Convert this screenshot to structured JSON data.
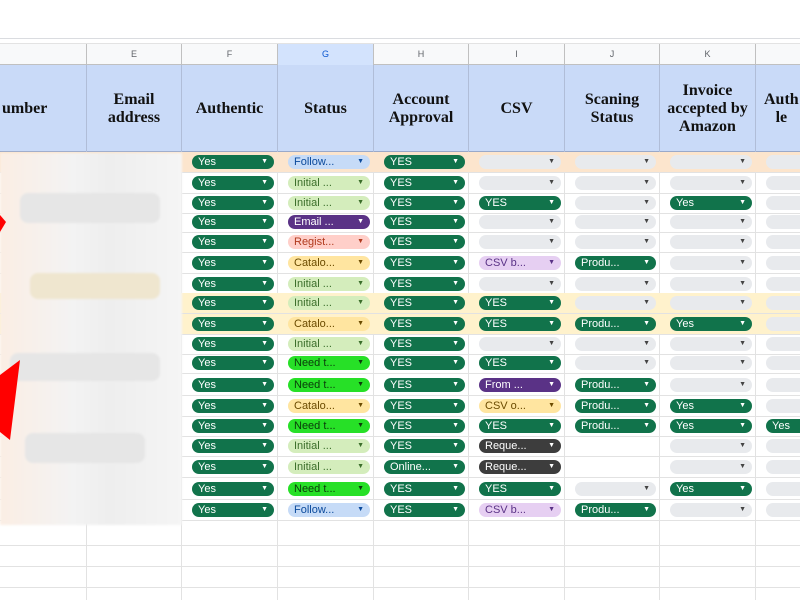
{
  "columns": {
    "letters": [
      "",
      "E",
      "F",
      "G",
      "H",
      "I",
      "J",
      "K",
      ""
    ],
    "headers": [
      "umber",
      "Email\naddress",
      "Authentic",
      "Status",
      "Account\nApproval",
      "CSV",
      "Scaning\nStatus",
      "Invoice\naccepted by\nAmazon",
      "Auth\nle"
    ]
  },
  "rows": [
    {
      "highlight": "orange",
      "F": "Yes",
      "G": "Follow...",
      "H": "YES",
      "I": "",
      "J": "",
      "K": "",
      "L": ""
    },
    {
      "highlight": "",
      "F": "Yes",
      "G": "Initial ...",
      "H": "YES",
      "I": "",
      "J": "",
      "K": "",
      "L": ""
    },
    {
      "highlight": "",
      "F": "Yes",
      "G": "Initial ...",
      "H": "YES",
      "I": "YES",
      "J": "",
      "K": "Yes",
      "L": ""
    },
    {
      "highlight": "",
      "F": "Yes",
      "G": "Email ...",
      "H": "YES",
      "I": "",
      "J": "",
      "K": "",
      "L": ""
    },
    {
      "highlight": "",
      "F": "Yes",
      "G": "Regist...",
      "H": "YES",
      "I": "",
      "J": "",
      "K": "",
      "L": ""
    },
    {
      "highlight": "",
      "F": "Yes",
      "G": "Catalo...",
      "H": "YES",
      "I": "CSV b...",
      "J": "Produ...",
      "K": "",
      "L": ""
    },
    {
      "highlight": "",
      "F": "Yes",
      "G": "Initial ...",
      "H": "YES",
      "I": "",
      "J": "",
      "K": "",
      "L": ""
    },
    {
      "highlight": "yellow",
      "F": "Yes",
      "G": "Initial ...",
      "H": "YES",
      "I": "YES",
      "J": "",
      "K": "",
      "L": ""
    },
    {
      "highlight": "yellow",
      "F": "Yes",
      "G": "Catalo...",
      "H": "YES",
      "I": "YES",
      "J": "Produ...",
      "K": "Yes",
      "L": ""
    },
    {
      "highlight": "",
      "F": "Yes",
      "G": "Initial ...",
      "H": "YES",
      "I": "",
      "J": "",
      "K": "",
      "L": ""
    },
    {
      "highlight": "",
      "F": "Yes",
      "G": "Need t...",
      "H": "YES",
      "I": "YES",
      "J": "",
      "K": "",
      "L": ""
    },
    {
      "highlight": "",
      "F": "Yes",
      "G": "Need t...",
      "H": "YES",
      "I": "From ...",
      "J": "Produ...",
      "K": "",
      "L": ""
    },
    {
      "highlight": "",
      "F": "Yes",
      "G": "Catalo...",
      "H": "YES",
      "I": "CSV o...",
      "J": "Produ...",
      "K": "Yes",
      "L": ""
    },
    {
      "highlight": "",
      "F": "Yes",
      "G": "Need t...",
      "H": "YES",
      "I": "YES",
      "J": "Produ...",
      "K": "Yes",
      "L": "Yes"
    },
    {
      "highlight": "",
      "F": "Yes",
      "G": "Initial ...",
      "H": "YES",
      "I": "Reque...",
      "J": "",
      "K": "",
      "L": ""
    },
    {
      "highlight": "",
      "F": "Yes",
      "G": "Initial ...",
      "H": "Online...",
      "I": "Reque...",
      "J": "",
      "K": "",
      "L": ""
    },
    {
      "highlight": "",
      "F": "Yes",
      "G": "Need t...",
      "H": "YES",
      "I": "YES",
      "J": "",
      "K": "Yes",
      "L": ""
    },
    {
      "highlight": "",
      "F": "Yes",
      "G": "Follow...",
      "H": "YES",
      "I": "CSV b...",
      "J": "Produ...",
      "K": "",
      "L": ""
    }
  ],
  "colors": {
    "header_bg": "#c9daf8",
    "chip_green": "#11734b",
    "arrow_red": "#ff0000"
  },
  "icons": [
    "dropdown-arrow-icon",
    "red-arrow-annotation"
  ]
}
